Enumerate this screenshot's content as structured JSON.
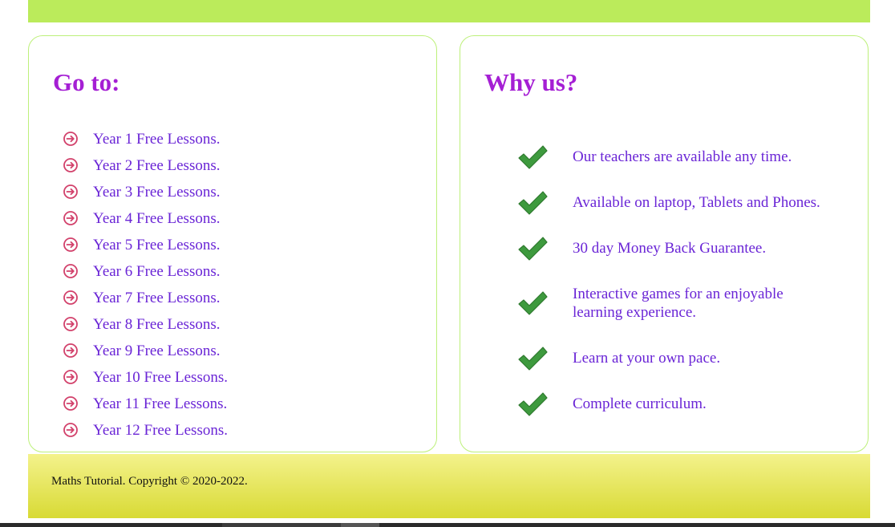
{
  "colors": {
    "topbar": "#bbeb5b",
    "heading": "#a51fd4",
    "link": "#6a25d6",
    "arrow_icon": "#d2416b",
    "check_icon": "#3e9a3e",
    "card_border": "#bdf07a",
    "footer_top": "#f4f28c",
    "footer_bottom": "#d8da34"
  },
  "goto": {
    "title": "Go to:",
    "icon": "circle-arrow-right-icon",
    "items": [
      "Year 1 Free Lessons.",
      "Year 2 Free Lessons.",
      "Year 3 Free Lessons.",
      "Year 4 Free Lessons.",
      "Year 5 Free Lessons.",
      "Year 6 Free Lessons.",
      "Year 7 Free Lessons.",
      "Year 8 Free Lessons.",
      "Year 9 Free Lessons.",
      "Year 10 Free Lessons.",
      "Year 11 Free Lessons.",
      "Year 12 Free Lessons."
    ]
  },
  "why": {
    "title": "Why us?",
    "icon": "checkmark-icon",
    "items": [
      "Our teachers are available any time.",
      "Available on laptop, Tablets and Phones.",
      "30 day Money Back Guarantee.",
      "Interactive games for an enjoyable learning experience.",
      "Learn at your own pace.",
      "Complete curriculum."
    ]
  },
  "footer": {
    "text": "Maths Tutorial. Copyright © 2020-2022."
  }
}
